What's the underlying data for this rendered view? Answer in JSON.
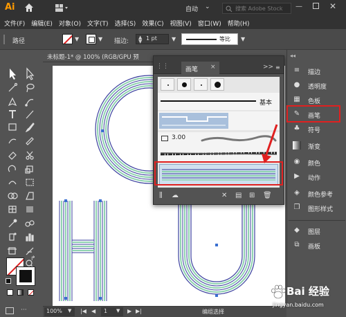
{
  "app": {
    "logo": "Ai",
    "workspace": "自动",
    "stock_search_placeholder": "搜索 Adobe Stock"
  },
  "menubar": {
    "items": [
      "文件(F)",
      "编辑(E)",
      "对象(O)",
      "文字(T)",
      "选择(S)",
      "效果(C)",
      "视图(V)",
      "窗口(W)",
      "帮助(H)"
    ]
  },
  "controlbar": {
    "selection_label": "路径",
    "stroke_label": "描边:",
    "stroke_weight": "1 pt",
    "profile_label": "等比"
  },
  "document": {
    "tab_title": "未标题-1* @ 100% (RGB/GPU 预"
  },
  "brush_panel": {
    "tab_label": "画笔",
    "basic_label": "基本",
    "art_brush_size": "3.00",
    "collapse_glyph": ">>"
  },
  "dock": {
    "items": [
      {
        "icon": "stroke-icon",
        "label": "描边"
      },
      {
        "icon": "transparency-icon",
        "label": "透明度"
      },
      {
        "icon": "swatches-icon",
        "label": "色板"
      },
      {
        "icon": "brush-icon",
        "label": "画笔"
      },
      {
        "icon": "symbol-icon",
        "label": "符号"
      },
      {
        "icon": "gradient-icon",
        "label": "渐变"
      },
      {
        "icon": "color-icon",
        "label": "颜色"
      },
      {
        "icon": "actions-icon",
        "label": "动作"
      },
      {
        "icon": "color-guide-icon",
        "label": "颜色参考"
      },
      {
        "icon": "graphic-styles-icon",
        "label": "图形样式"
      },
      {
        "icon": "layers-icon",
        "label": "图层"
      },
      {
        "icon": "artboards-icon",
        "label": "画板"
      }
    ]
  },
  "statusbar": {
    "zoom": "100%",
    "page": "1",
    "mode": "编组选择"
  },
  "watermark": {
    "brand": "Bai 经验",
    "url": "jingyan.baidu.com"
  },
  "colors": {
    "highlight": "#e02020",
    "stroke_blue": "#3a3f9e",
    "stroke_green": "#8fd3b0",
    "accent_orange": "#ff9a00"
  }
}
